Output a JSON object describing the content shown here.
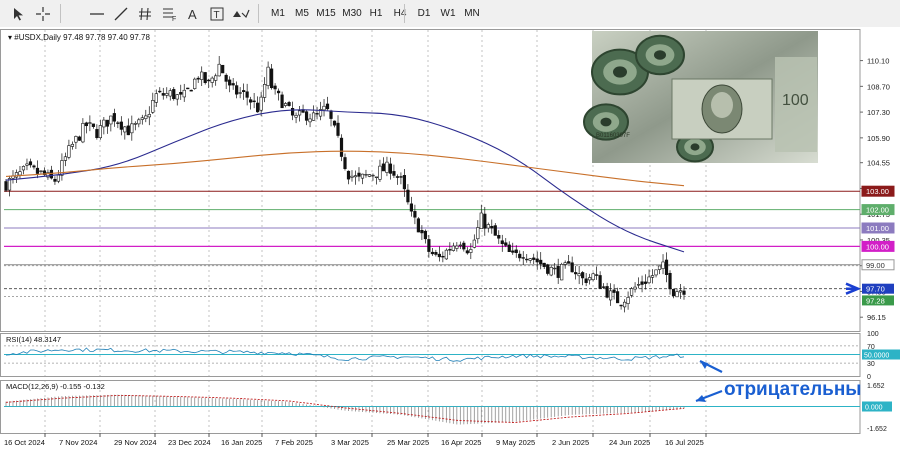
{
  "toolbar": {
    "timeframes": [
      "M1",
      "M5",
      "M15",
      "M30",
      "H1",
      "H4",
      "D1",
      "W1",
      "MN"
    ],
    "icons": [
      "cursor-icon",
      "crosshair-icon",
      "horizontal-line-icon",
      "trendline-icon",
      "hash-icon",
      "fibonacci-icon",
      "text-icon",
      "label-icon",
      "shapes-icon"
    ]
  },
  "main": {
    "header": "#USDX,Daily  97.48 97.78 97.40 97.78",
    "price_ticks": [
      "110.10",
      "108.70",
      "107.30",
      "105.90",
      "104.55",
      "103.15",
      "101.75",
      "100.35",
      "98.95",
      "97.55",
      "96.15"
    ],
    "horizontal_levels": [
      {
        "label": "103.00",
        "value": 103.0,
        "color": "#8b1a1a",
        "label_bg": "#8b1a1a",
        "label_fg": "#ffffff"
      },
      {
        "label": "102.00",
        "value": 102.0,
        "color": "#5fae6b",
        "label_bg": "#5fae6b",
        "label_fg": "#ffffff"
      },
      {
        "label": "101.00",
        "value": 101.0,
        "color": "#8c7bbf",
        "label_bg": "#8c7bbf",
        "label_fg": "#ffffff"
      },
      {
        "label": "100.00",
        "value": 100.0,
        "color": "#d21fc7",
        "label_bg": "#d21fc7",
        "label_fg": "#ffffff"
      },
      {
        "label": "99.00",
        "value": 99.0,
        "color": "#8a8a8a",
        "label_bg": "#ffffff",
        "label_fg": "#333333"
      }
    ],
    "current_price": {
      "label": "97.70",
      "value": 97.7,
      "color": "#1f3fbf"
    },
    "alt_price": {
      "label": "97.28",
      "value": 97.28,
      "color": "#3a9a4a"
    }
  },
  "rsi": {
    "header": "RSI(14) 48.3147",
    "ticks": [
      "100",
      "70",
      "30",
      "0"
    ],
    "level_label": "50.0000"
  },
  "macd": {
    "header": "MACD(12,26,9) -0.155 -0.132",
    "ticks": [
      "1.652",
      "-1.652"
    ],
    "zero_label": "0.000"
  },
  "x_axis": {
    "dates": [
      "16 Oct 2024",
      "7 Nov 2024",
      "29 Nov 2024",
      "23 Dec 2024",
      "16 Jan 2025",
      "7 Feb 2025",
      "3 Mar 2025",
      "25 Mar 2025",
      "16 Apr 2025",
      "9 May 2025",
      "2 Jun 2025",
      "24 Jun 2025",
      "16 Jul 2025"
    ]
  },
  "annotation": {
    "text": "отрицательны",
    "color": "#1a5fd1"
  },
  "photo": {
    "content": "US dollar banknotes",
    "note_serial": "B01160397F",
    "portrait": "Benjamin Franklin",
    "lettering": "THE UNITED STATES OF AMERICA"
  },
  "chart_data": [
    {
      "type": "candlestick",
      "title": "#USDX,Daily",
      "ohlc_last": {
        "open": 97.48,
        "high": 97.78,
        "low": 97.4,
        "close": 97.78
      },
      "x": [
        "2024-10-16",
        "2024-11-07",
        "2024-11-29",
        "2024-12-23",
        "2025-01-16",
        "2025-02-07",
        "2025-03-03",
        "2025-03-25",
        "2025-04-16",
        "2025-05-09",
        "2025-06-02",
        "2025-06-24",
        "2025-07-16"
      ],
      "close_approx": [
        103.5,
        104.5,
        106.5,
        108.3,
        108.8,
        107.6,
        106.8,
        104.2,
        99.4,
        100.3,
        98.8,
        97.2,
        98.1
      ],
      "ylim": [
        95.5,
        111.0
      ],
      "series": [
        {
          "name": "MA slow",
          "color": "#2b2b8f",
          "values": [
            103.6,
            103.9,
            104.4,
            105.7,
            106.9,
            107.5,
            107.3,
            107.2,
            106.3,
            104.9,
            102.6,
            100.7,
            99.7
          ]
        },
        {
          "name": "MA fast",
          "color": "#c8702a",
          "values": [
            103.8,
            104.0,
            104.3,
            104.5,
            104.8,
            105.1,
            105.2,
            105.1,
            104.8,
            104.4,
            104.0,
            103.6,
            103.3
          ]
        }
      ]
    },
    {
      "type": "line",
      "title": "RSI(14) 48.3147",
      "ylim": [
        0,
        100
      ],
      "x": [
        "2024-10-16",
        "2024-11-07",
        "2024-11-29",
        "2024-12-23",
        "2025-01-16",
        "2025-02-07",
        "2025-03-03",
        "2025-03-25",
        "2025-04-16",
        "2025-05-09",
        "2025-06-02",
        "2025-06-24",
        "2025-07-16"
      ],
      "values": [
        52,
        62,
        60,
        58,
        56,
        54,
        40,
        45,
        38,
        47,
        45,
        40,
        48
      ]
    },
    {
      "type": "bar",
      "title": "MACD(12,26,9) -0.155 -0.132",
      "ylim": [
        -1.652,
        1.652
      ],
      "x": [
        "2024-10-16",
        "2024-11-07",
        "2024-11-29",
        "2024-12-23",
        "2025-01-16",
        "2025-02-07",
        "2025-03-03",
        "2025-03-25",
        "2025-04-16",
        "2025-05-09",
        "2025-06-02",
        "2025-06-24",
        "2025-07-16"
      ],
      "values": [
        0.35,
        0.75,
        0.85,
        0.7,
        0.55,
        0.35,
        -0.3,
        -0.6,
        -1.3,
        -1.1,
        -0.6,
        -0.45,
        -0.155
      ],
      "signal": [
        0.3,
        0.6,
        0.8,
        0.72,
        0.6,
        0.4,
        -0.1,
        -0.5,
        -1.0,
        -1.15,
        -0.75,
        -0.5,
        -0.132
      ]
    }
  ]
}
